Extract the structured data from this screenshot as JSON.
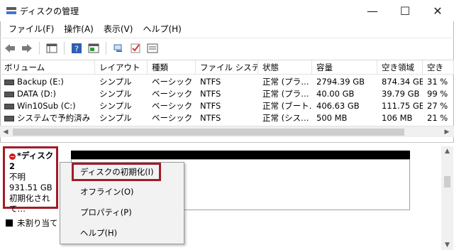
{
  "window": {
    "title": "ディスクの管理"
  },
  "controls": {
    "minimize": "—",
    "maximize": "☐",
    "close": "✕"
  },
  "menubar": [
    {
      "label": "ファイル(F)"
    },
    {
      "label": "操作(A)"
    },
    {
      "label": "表示(V)"
    },
    {
      "label": "ヘルプ(H)"
    }
  ],
  "toolbar": {
    "icons": [
      "back-arrow-icon",
      "forward-arrow-icon",
      "show-hide-console-tree-icon",
      "help-icon",
      "show-hide-action-pane-icon",
      "connect-icon",
      "check-icon",
      "properties-icon"
    ]
  },
  "table": {
    "columns": [
      "ボリューム",
      "レイアウト",
      "種類",
      "ファイル システム",
      "状態",
      "容量",
      "空き領域",
      "空き"
    ],
    "rows": [
      {
        "volume": "Backup (E:)",
        "layout": "シンプル",
        "type": "ベーシック",
        "fs": "NTFS",
        "status": "正常 (プラ…",
        "capacity": "2794.39 GB",
        "free": "874.34 GB",
        "pct": "31 %"
      },
      {
        "volume": "DATA (D:)",
        "layout": "シンプル",
        "type": "ベーシック",
        "fs": "NTFS",
        "status": "正常 (プラ…",
        "capacity": "40.00 GB",
        "free": "39.79 GB",
        "pct": "99 %"
      },
      {
        "volume": "Win10Sub (C:)",
        "layout": "シンプル",
        "type": "ベーシック",
        "fs": "NTFS",
        "status": "正常 (ブート…",
        "capacity": "406.63 GB",
        "free": "111.75 GB",
        "pct": "27 %"
      },
      {
        "volume": "システムで予約済み",
        "layout": "シンプル",
        "type": "ベーシック",
        "fs": "NTFS",
        "status": "正常 (シス…",
        "capacity": "500 MB",
        "free": "106 MB",
        "pct": "21 %"
      }
    ]
  },
  "disk": {
    "title": "*ディスク 2",
    "state": "不明",
    "size": "931.51 GB",
    "status": "初期化されて…"
  },
  "legend": {
    "label": "未割り当て"
  },
  "context_menu": {
    "items": [
      "ディスクの初期化(I)",
      "オフライン(O)",
      "プロパティ(P)",
      "ヘルプ(H)"
    ]
  },
  "colors": {
    "highlight_border": "#a01c28",
    "unallocated": "#000000"
  }
}
